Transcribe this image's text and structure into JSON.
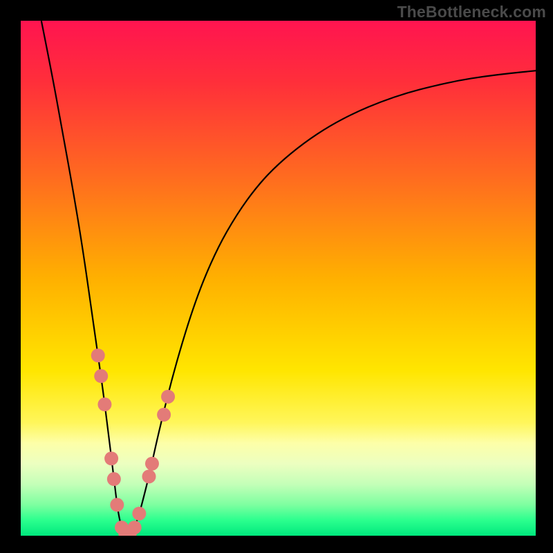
{
  "watermark": "TheBottleneck.com",
  "chart_data": {
    "type": "line",
    "title": "",
    "xlabel": "",
    "ylabel": "",
    "xlim": [
      0,
      100
    ],
    "ylim": [
      0,
      100
    ],
    "annotations": [],
    "background": {
      "type": "vertical-gradient",
      "stops": [
        {
          "pos": 0.0,
          "color": "#ff1450"
        },
        {
          "pos": 0.12,
          "color": "#ff2f3a"
        },
        {
          "pos": 0.3,
          "color": "#ff6a20"
        },
        {
          "pos": 0.5,
          "color": "#ffb000"
        },
        {
          "pos": 0.68,
          "color": "#ffe600"
        },
        {
          "pos": 0.78,
          "color": "#fff65a"
        },
        {
          "pos": 0.82,
          "color": "#fdffa8"
        },
        {
          "pos": 0.86,
          "color": "#ecffc0"
        },
        {
          "pos": 0.9,
          "color": "#c4ffb8"
        },
        {
          "pos": 0.94,
          "color": "#7dffa0"
        },
        {
          "pos": 0.97,
          "color": "#2bff8e"
        },
        {
          "pos": 1.0,
          "color": "#00e87d"
        }
      ]
    },
    "series": [
      {
        "name": "curve",
        "color": "#000000",
        "stroke_width": 2.2,
        "x": [
          4,
          6,
          8,
          10,
          12,
          14,
          15,
          16,
          17,
          18,
          18.7,
          19.3,
          20,
          20.7,
          21.5,
          22.5,
          23.5,
          25,
          27,
          30,
          34,
          38,
          42,
          46,
          50,
          55,
          60,
          65,
          70,
          75,
          80,
          85,
          90,
          95,
          100
        ],
        "y": [
          100,
          90,
          79,
          68,
          56,
          42,
          35,
          28,
          20,
          12,
          6,
          2.5,
          0.8,
          0.3,
          0.8,
          2.5,
          6,
          12,
          21,
          33,
          46,
          55.5,
          62.5,
          68,
          72.2,
          76.3,
          79.6,
          82.2,
          84.3,
          86,
          87.3,
          88.4,
          89.2,
          89.8,
          90.3
        ]
      }
    ],
    "markers": {
      "color": "#e37b78",
      "radius": 10,
      "points": [
        {
          "x": 15.0,
          "y": 35.0
        },
        {
          "x": 15.6,
          "y": 31.0
        },
        {
          "x": 16.3,
          "y": 25.5
        },
        {
          "x": 17.6,
          "y": 15.0
        },
        {
          "x": 18.1,
          "y": 11.0
        },
        {
          "x": 18.7,
          "y": 6.0
        },
        {
          "x": 19.6,
          "y": 1.6
        },
        {
          "x": 20.3,
          "y": 0.4
        },
        {
          "x": 21.2,
          "y": 0.5
        },
        {
          "x": 22.1,
          "y": 1.6
        },
        {
          "x": 23.0,
          "y": 4.3
        },
        {
          "x": 24.9,
          "y": 11.5
        },
        {
          "x": 25.5,
          "y": 14.0
        },
        {
          "x": 27.8,
          "y": 23.5
        },
        {
          "x": 28.6,
          "y": 27.0
        }
      ]
    }
  }
}
